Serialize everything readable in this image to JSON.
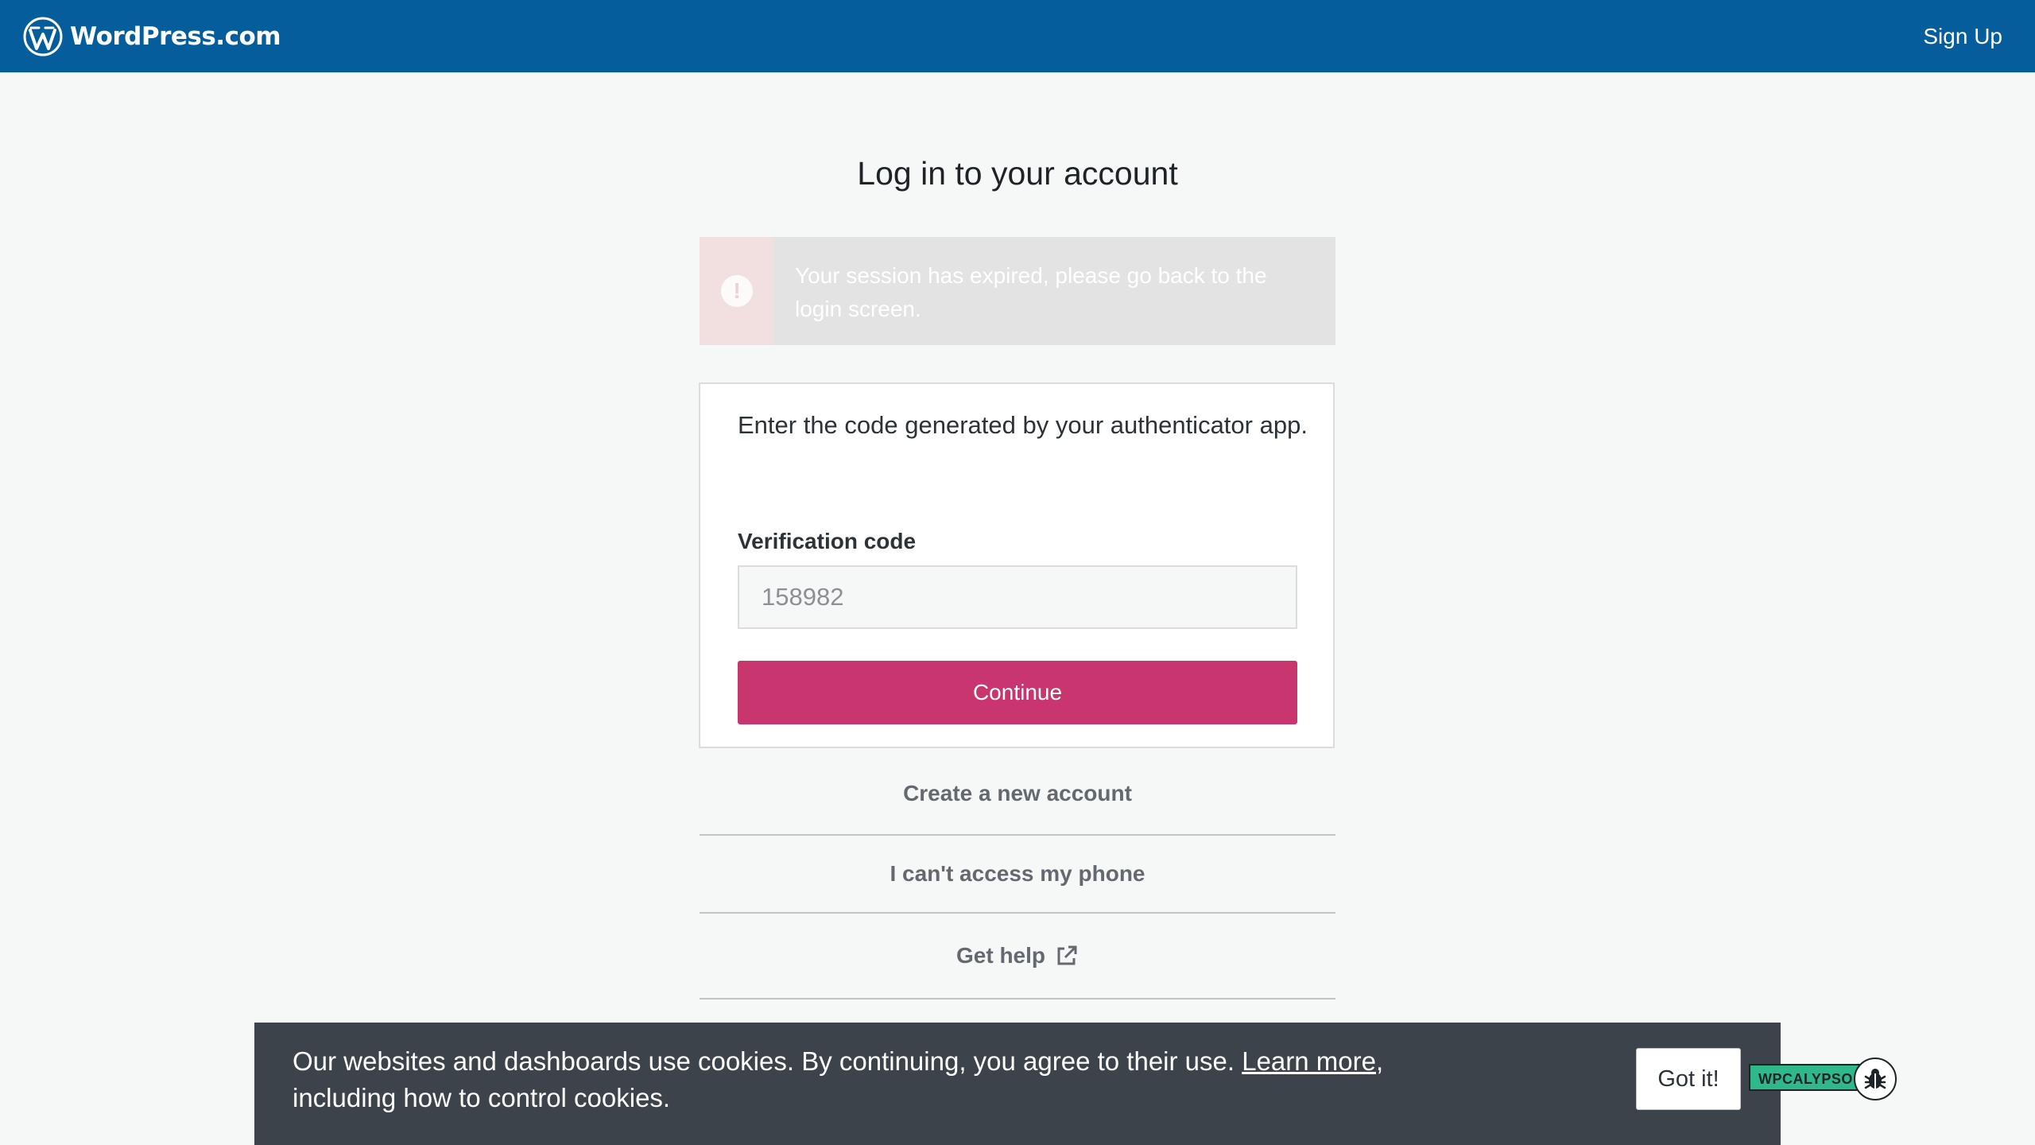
{
  "masterbar": {
    "brand": "WordPress.com",
    "signup_label": "Sign Up",
    "background": "#055d9c"
  },
  "login": {
    "title": "Log in to your account",
    "notice": {
      "icon": "error-icon",
      "icon_glyph": "!",
      "message": "Your session has expired, please go back to the login screen."
    },
    "card": {
      "intro": "Enter the code generated by your authenticator app.",
      "field_label": "Verification code",
      "input_value": "",
      "input_placeholder": "158982",
      "continue_label": "Continue",
      "accent": "#c9356e"
    },
    "links": {
      "create_account": "Create a new account",
      "cant_access_phone": "I can't access my phone",
      "get_help": "Get help"
    }
  },
  "cookie_banner": {
    "text_before": "Our websites and dashboards use cookies. By continuing, you agree to their use. ",
    "learn_more": "Learn more",
    "text_after": ", including how to control cookies.",
    "button_label": "Got it!"
  },
  "environment_badge": {
    "label": "WPCALYPSO",
    "icon": "bug-icon",
    "color": "#2fb88a"
  }
}
